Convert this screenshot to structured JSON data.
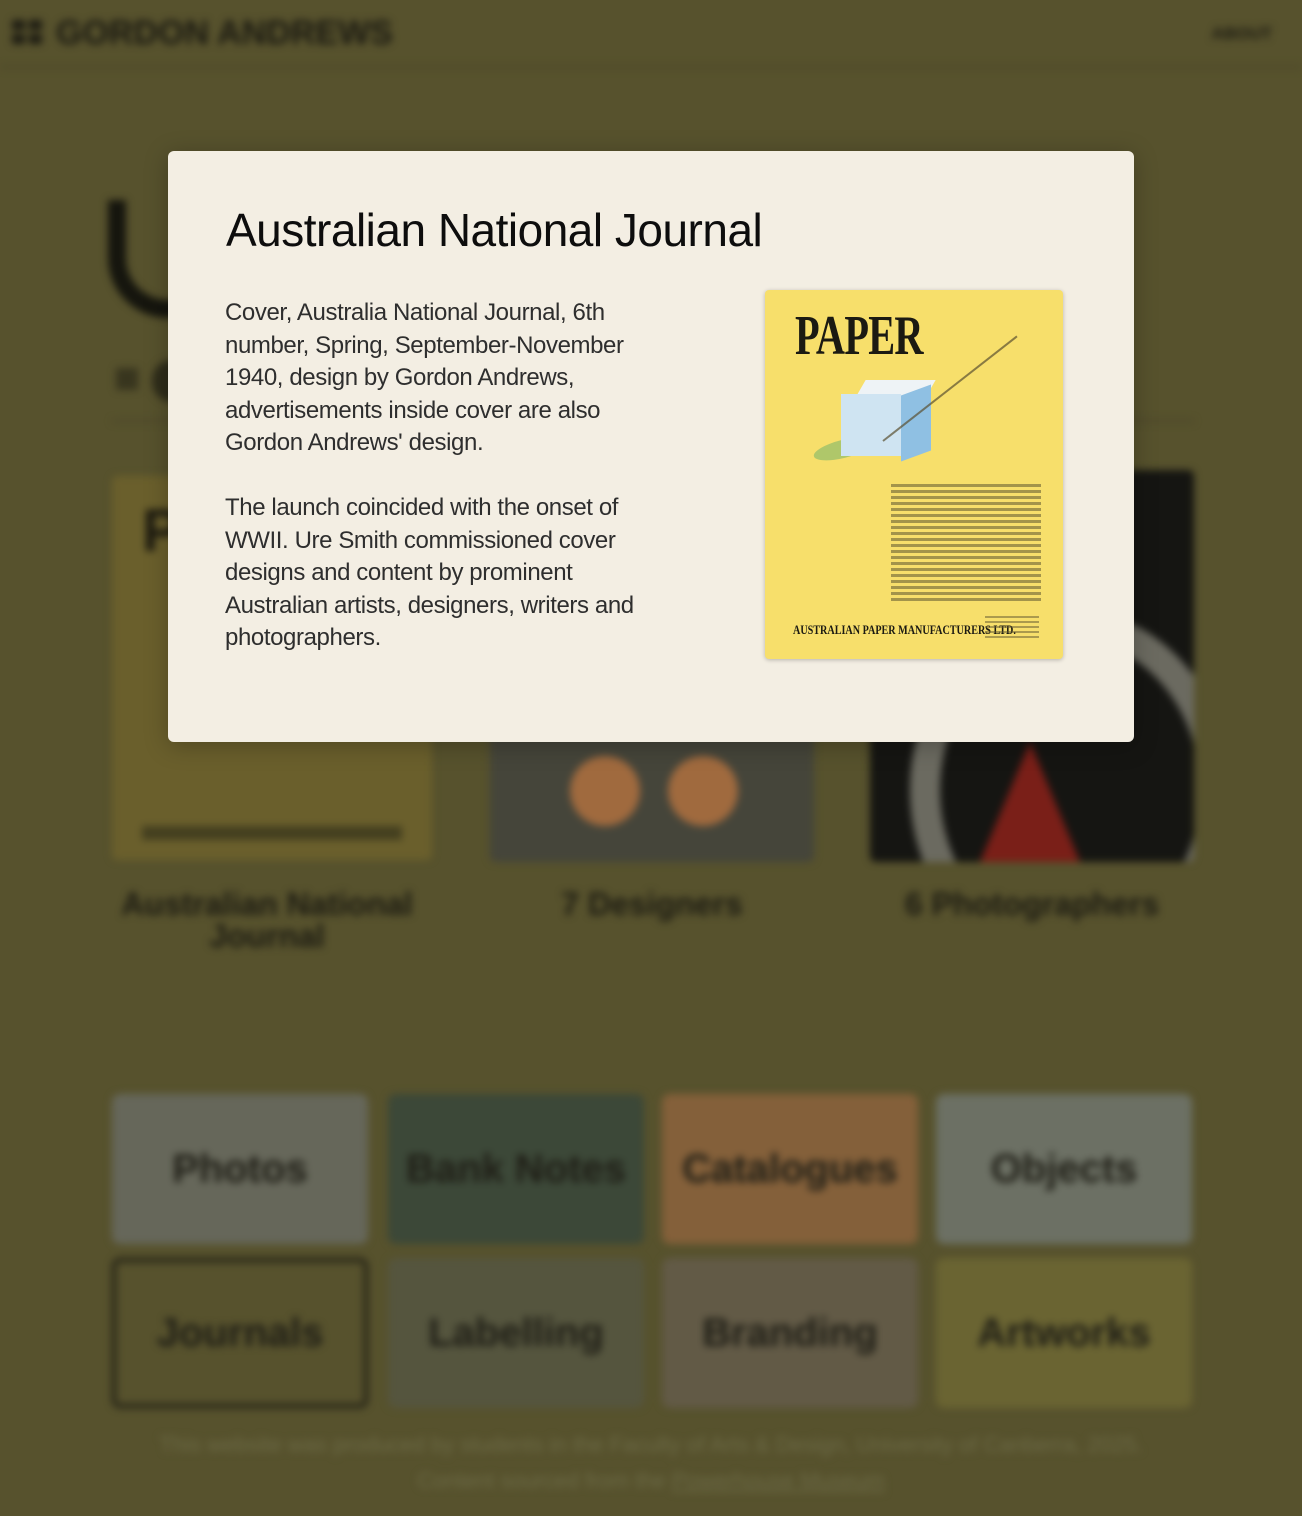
{
  "header": {
    "brand": "GORDON ANDREWS",
    "about": "ABOUT"
  },
  "gallery": {
    "cards": [
      {
        "label": "Australian National Journal"
      },
      {
        "label": "7 Designers"
      },
      {
        "label": "6 Photographers"
      }
    ],
    "cover_title_1": "P"
  },
  "categories": [
    {
      "label": "Photos"
    },
    {
      "label": "Bank Notes"
    },
    {
      "label": "Catalogues"
    },
    {
      "label": "Objects"
    },
    {
      "label": "Journals"
    },
    {
      "label": "Labelling"
    },
    {
      "label": "Branding"
    },
    {
      "label": "Artworks"
    }
  ],
  "footer": {
    "line1": "This website was produced by students in the Faculty of Arts & Design, University of Canberra, 2025.",
    "line2_prefix": "Content sourced from the ",
    "line2_link": "Powerhouse Museum"
  },
  "modal": {
    "title": "Australian National Journal",
    "paragraph1": "Cover, Australia National Journal, 6th number, Spring, September-November 1940, design by Gordon Andrews, advertisements inside cover are also Gordon Andrews' design.",
    "paragraph2": "The launch coincided with the onset of WWII. Ure Smith commissioned cover designs and content by prominent Australian artists, designers, writers and photographers.",
    "image": {
      "headline": "PAPER",
      "maker": "AUSTRALIAN PAPER MANUFACTURERS LTD.",
      "background_color": "#f7df6b"
    }
  },
  "colors": {
    "overlay_bg": "#57522d",
    "modal_bg": "#f3eee3"
  }
}
